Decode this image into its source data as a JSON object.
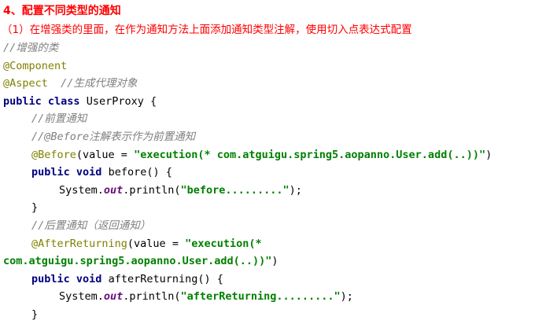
{
  "heading": "4、配置不同类型的通知",
  "subheading": "（1）在增强类的里面，在作为通知方法上面添加通知类型注解，使用切入点表达式配置",
  "code": {
    "comment_enhanced_class": "//增强的类",
    "ann_component": "@Component",
    "ann_aspect": "@Aspect",
    "comment_proxy": "//生成代理对象",
    "kw_public": "public",
    "kw_class": "class",
    "class_decl_rest": " UserProxy {",
    "comment_before": "//前置通知",
    "comment_before_ann": "//@Before注解表示作为前置通知",
    "ann_before": "@Before",
    "before_ann_args_open": "(value = ",
    "before_expression": "\"execution(* com.atguigu.spring5.aopanno.User.add(..))\"",
    "close_paren": ")",
    "kw_void": "void",
    "method_before_rest": " before() {",
    "system_prefix": "System.",
    "out_field": "out",
    "println_open": ".println(",
    "before_message": "\"before.........\"",
    "stmt_end": ");",
    "brace_close": "}",
    "comment_after_returning": "//后置通知（返回通知）",
    "ann_after_returning": "@AfterReturning",
    "after_ann_args_open": "(value = ",
    "after_expression_part1": "\"execution(*",
    "after_expression_part2": "com.atguigu.spring5.aopanno.User.add(..))\"",
    "method_after_rest": " afterReturning() {",
    "after_message": "\"afterReturning.........\""
  },
  "colors": {
    "heading": "#ff0000",
    "comment": "#808080",
    "annotation": "#808000",
    "keyword": "#000080",
    "string": "#008000",
    "static_field": "#660e7a"
  }
}
